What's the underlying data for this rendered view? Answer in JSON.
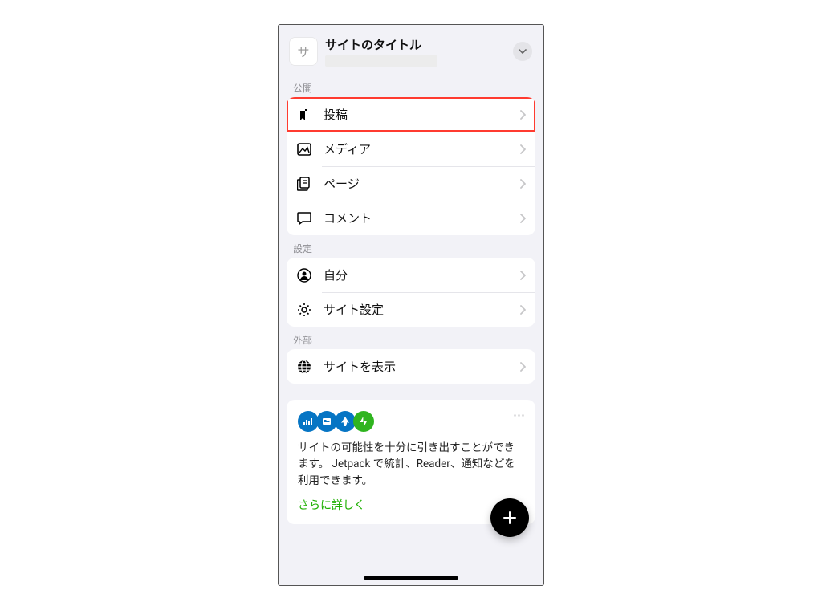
{
  "header": {
    "site_badge": "サ",
    "site_title": "サイトのタイトル"
  },
  "sections": {
    "publish": {
      "label": "公開"
    },
    "settings": {
      "label": "設定"
    },
    "external": {
      "label": "外部"
    }
  },
  "rows": {
    "posts": "投稿",
    "media": "メディア",
    "pages": "ページ",
    "comments": "コメント",
    "me": "自分",
    "site_settings": "サイト設定",
    "view_site": "サイトを表示"
  },
  "jetpack": {
    "text": "サイトの可能性を十分に引き出すことができます。 Jetpack で統計、Reader、通知などを利用できます。",
    "link": "さらに詳しく"
  },
  "colors": {
    "highlight": "#ff3b30",
    "icon_blue": "#0675c4",
    "icon_green": "#2fb41f",
    "link_green": "#1db000"
  }
}
